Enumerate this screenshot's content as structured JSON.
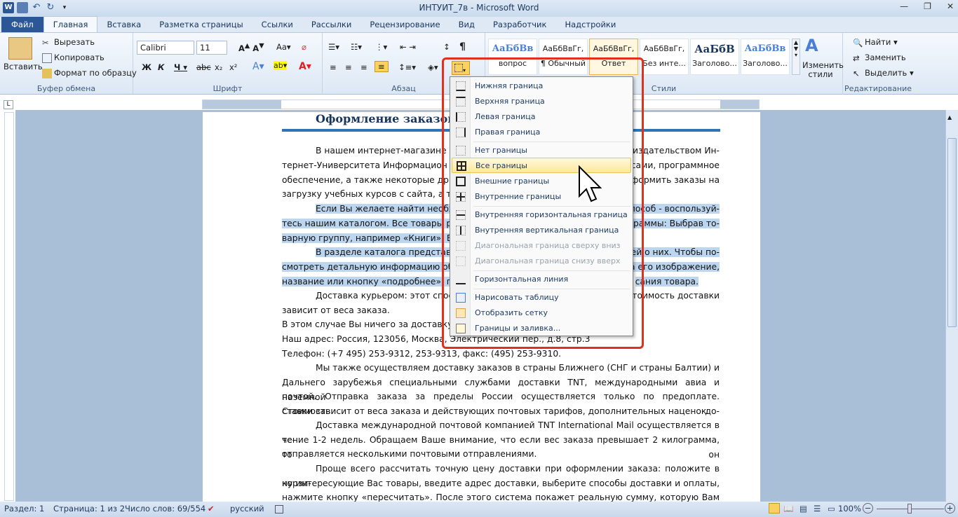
{
  "window": {
    "title": "ИНТУИТ_7в - Microsoft Word"
  },
  "tabs": [
    "Файл",
    "Главная",
    "Вставка",
    "Разметка страницы",
    "Ссылки",
    "Рассылки",
    "Рецензирование",
    "Вид",
    "Разработчик",
    "Надстройки"
  ],
  "clipboard": {
    "paste": "Вставить",
    "cut": "Вырезать",
    "copy": "Копировать",
    "format_painter": "Формат по образцу",
    "label": "Буфер обмена"
  },
  "font": {
    "name": "Calibri",
    "size": "11",
    "label": "Шрифт"
  },
  "paragraph": {
    "label": "Абзац"
  },
  "styles": {
    "items": [
      {
        "preview": "АаБбВв",
        "name": "вопрос"
      },
      {
        "preview": "АаБбВвГг,",
        "name": "¶ Обычный"
      },
      {
        "preview": "АаБбВвГг,",
        "name": "Ответ"
      },
      {
        "preview": "АаБбВвГг,",
        "name": "Без инте..."
      },
      {
        "preview": "АаБбВ",
        "name": "Заголово..."
      },
      {
        "preview": "АаБбВв",
        "name": "Заголово..."
      }
    ],
    "change": "Изменить стили",
    "label": "Стили"
  },
  "editing": {
    "find": "Найти",
    "replace": "Заменить",
    "select": "Выделить",
    "label": "Редактирование"
  },
  "menu": {
    "items": [
      {
        "label": "Нижняя граница",
        "disabled": false
      },
      {
        "label": "Верхняя граница",
        "disabled": false
      },
      {
        "label": "Левая граница",
        "disabled": false
      },
      {
        "label": "Правая граница",
        "disabled": false
      },
      {
        "label": "Нет границы",
        "disabled": false
      },
      {
        "label": "Все границы",
        "disabled": false
      },
      {
        "label": "Внешние границы",
        "disabled": false
      },
      {
        "label": "Внутренние границы",
        "disabled": false
      },
      {
        "label": "Внутренняя горизонтальная граница",
        "disabled": false
      },
      {
        "label": "Внутренняя вертикальная граница",
        "disabled": false
      },
      {
        "label": "Диагональная граница сверху вниз",
        "disabled": true
      },
      {
        "label": "Диагональная граница снизу вверх",
        "disabled": true
      },
      {
        "label": "Горизонтальная линия",
        "disabled": false
      },
      {
        "label": "Нарисовать таблицу",
        "disabled": false
      },
      {
        "label": "Отобразить сетку",
        "disabled": false
      },
      {
        "label": "Границы и заливка...",
        "disabled": false
      }
    ]
  },
  "document": {
    "heading": "Оформление заказов",
    "lines": [
      "В нашем интернет-магазине п",
      "издательством Ин-",
      "тернет-Университета Информацион",
      "сами, программное",
      "обеспечение, а также некоторые др",
      "оформить заказы на",
      "загрузку учебных курсов с сайта, а так",
      "Если Вы желаете найти необх",
      "пособ - воспользуй-",
      "тесь нашим каталогом. Все товары р",
      "граммы: Выбрав то-",
      "варную группу, например «Книги», В",
      "В разделе каталога представ",
      "щей о них. Чтобы по-",
      "смотреть детальную информацию об",
      "а его изображение,",
      "название или кнопку «подробнее», п",
      "сания товара.",
      "Доставка курьером: этот спос",
      "Стоимость доставки",
      "зависит от веса заказа.",
      "В этом случае Вы ничего за доставку н",
      "Наш адрес: Россия, 123056, Москва, Электрический пер., д.8, стр.3",
      "Телефон: (+7 495) 253-9312, 253-9313, факс: (495) 253-9310.",
      "Мы также осуществляем доставку заказов в страны Ближнего (СНГ и страны Балтии) и",
      "Дальнего зарубежья специальными службами доставки TNT, международными авиа и наземной",
      "почтой. Отправка заказа за пределы России осуществляется только по предоплате. Стоимость до-",
      "ставки зависит от веса заказа и действующих почтовых тарифов, дополнительных наценок.",
      "Доставка международной почтовой компанией TNT International Mail осуществляется в те-",
      "чение 1-2 недель. Обращаем Ваше внимание, что если вес заказа превышает 2 килограмма, то он",
      "отправляется несколькими почтовыми отправлениями.",
      "Проще всего рассчитать точную цену доставки при оформлении заказа: положите в корзи-",
      "ну интересующие Вас товары, введите адрес доставки, выберите способы доставки и оплаты,",
      "нажмите кнопку «пересчитать». После этого система покажет реальную сумму, которую Вам необ-"
    ]
  },
  "status": {
    "section": "Раздел: 1",
    "page": "Страница: 1 из 2",
    "words": "Число слов: 69/554",
    "lang": "русский",
    "zoom": "100%"
  }
}
